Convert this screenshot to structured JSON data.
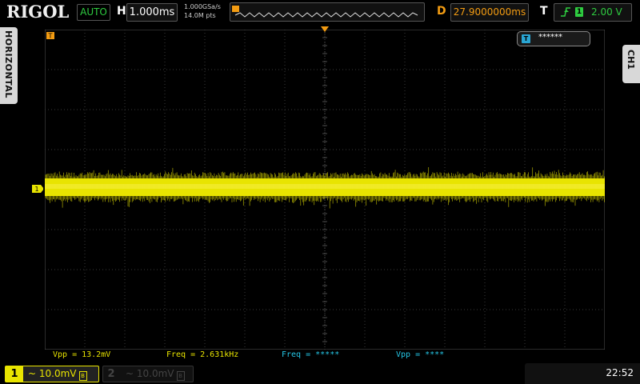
{
  "header": {
    "brand": "RIGOL",
    "run_mode": "AUTO",
    "horizontal_letter": "H",
    "timebase": "1.000ms",
    "sample_rate": "1.000GSa/s",
    "memory_depth": "14.0M pts",
    "delay_letter": "D",
    "delay": "27.9000000ms",
    "trigger_letter": "T",
    "trigger_source": "1",
    "trigger_level": "2.00 V"
  },
  "side": {
    "left_tab": "HORIZONTAL",
    "right_tab": "CH1"
  },
  "screen": {
    "trigger_status_text": "******",
    "trigger_status_icon": "T",
    "ch1_marker": "1",
    "t_marker": "T"
  },
  "measurements": [
    {
      "label": "Vpp = 13.2mV",
      "color": "#e8e400"
    },
    {
      "label": "Freq = 2.631kHz",
      "color": "#e8e400"
    },
    {
      "label": "Freq = *****",
      "color": "#25c8e8"
    },
    {
      "label": "Vpp = ****",
      "color": "#25c8e8"
    }
  ],
  "channels": [
    {
      "number": "1",
      "scale": "~ 10.0mV",
      "bw_icon": "B",
      "active": true,
      "color": "#e8e400"
    },
    {
      "number": "2",
      "scale": "~ 10.0mV",
      "bw_icon": "B",
      "active": false,
      "color": "#444444"
    }
  ],
  "footer": {
    "time": "22:52"
  },
  "colors": {
    "ch1": "#e8e400",
    "ch2": "#25c8e8",
    "accent": "#f39c12",
    "trigger": "#2ecc40",
    "grid": "#3a3a3a"
  }
}
